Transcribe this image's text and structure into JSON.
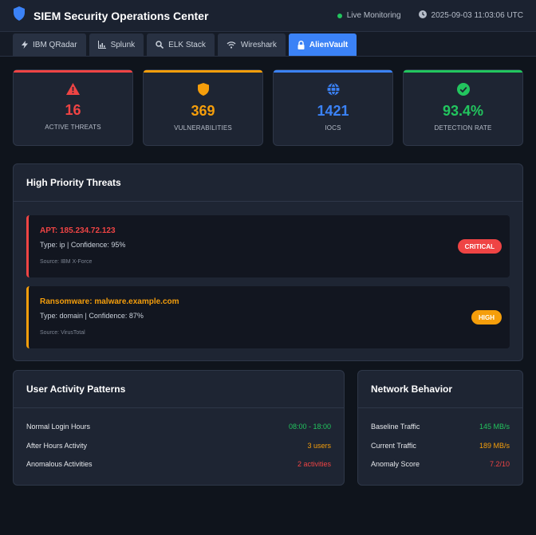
{
  "app": {
    "title": "SIEM Security Operations Center",
    "status": "Live Monitoring",
    "timestamp": "2025-09-03 11:03:06 UTC"
  },
  "tabs": [
    {
      "label": "IBM QRadar",
      "icon": "bolt-icon",
      "active": false
    },
    {
      "label": "Splunk",
      "icon": "chart-icon",
      "active": false
    },
    {
      "label": "ELK Stack",
      "icon": "search-icon",
      "active": false
    },
    {
      "label": "Wireshark",
      "icon": "wifi-icon",
      "active": false
    },
    {
      "label": "AlienVault",
      "icon": "lock-icon",
      "active": true
    }
  ],
  "stats": [
    {
      "value": "16",
      "label": "ACTIVE THREATS",
      "icon": "warning-icon",
      "color": "#ef4444"
    },
    {
      "value": "369",
      "label": "VULNERABILITIES",
      "icon": "shield-icon",
      "color": "#f59e0b"
    },
    {
      "value": "1421",
      "label": "IOCS",
      "icon": "globe-icon",
      "color": "#3b82f6"
    },
    {
      "value": "93.4%",
      "label": "DETECTION RATE",
      "icon": "check-circle-icon",
      "color": "#22c55e"
    }
  ],
  "threats_panel": {
    "title": "High Priority Threats",
    "items": [
      {
        "title": "APT: 185.234.72.123",
        "meta": "Type: ip | Confidence: 95%",
        "source": "Source: IBM X-Force",
        "severity": "CRITICAL",
        "color": "#ef4444"
      },
      {
        "title": "Ransomware: malware.example.com",
        "meta": "Type: domain | Confidence: 87%",
        "source": "Source: VirusTotal",
        "severity": "HIGH",
        "color": "#f59e0b"
      }
    ]
  },
  "user_activity": {
    "title": "User Activity Patterns",
    "rows": [
      {
        "key": "Normal Login Hours",
        "value": "08:00 - 18:00",
        "color": "#22c55e"
      },
      {
        "key": "After Hours Activity",
        "value": "3 users",
        "color": "#f59e0b"
      },
      {
        "key": "Anomalous Activities",
        "value": "2 activities",
        "color": "#ef4444"
      }
    ]
  },
  "network_behavior": {
    "title": "Network Behavior",
    "rows": [
      {
        "key": "Baseline Traffic",
        "value": "145 MB/s",
        "color": "#22c55e"
      },
      {
        "key": "Current Traffic",
        "value": "189 MB/s",
        "color": "#f59e0b"
      },
      {
        "key": "Anomaly Score",
        "value": "7.2/10",
        "color": "#ef4444"
      }
    ]
  },
  "colors": {
    "accent": "#3b82f6",
    "critical": "#ef4444",
    "high": "#f59e0b",
    "ok": "#22c55e"
  }
}
